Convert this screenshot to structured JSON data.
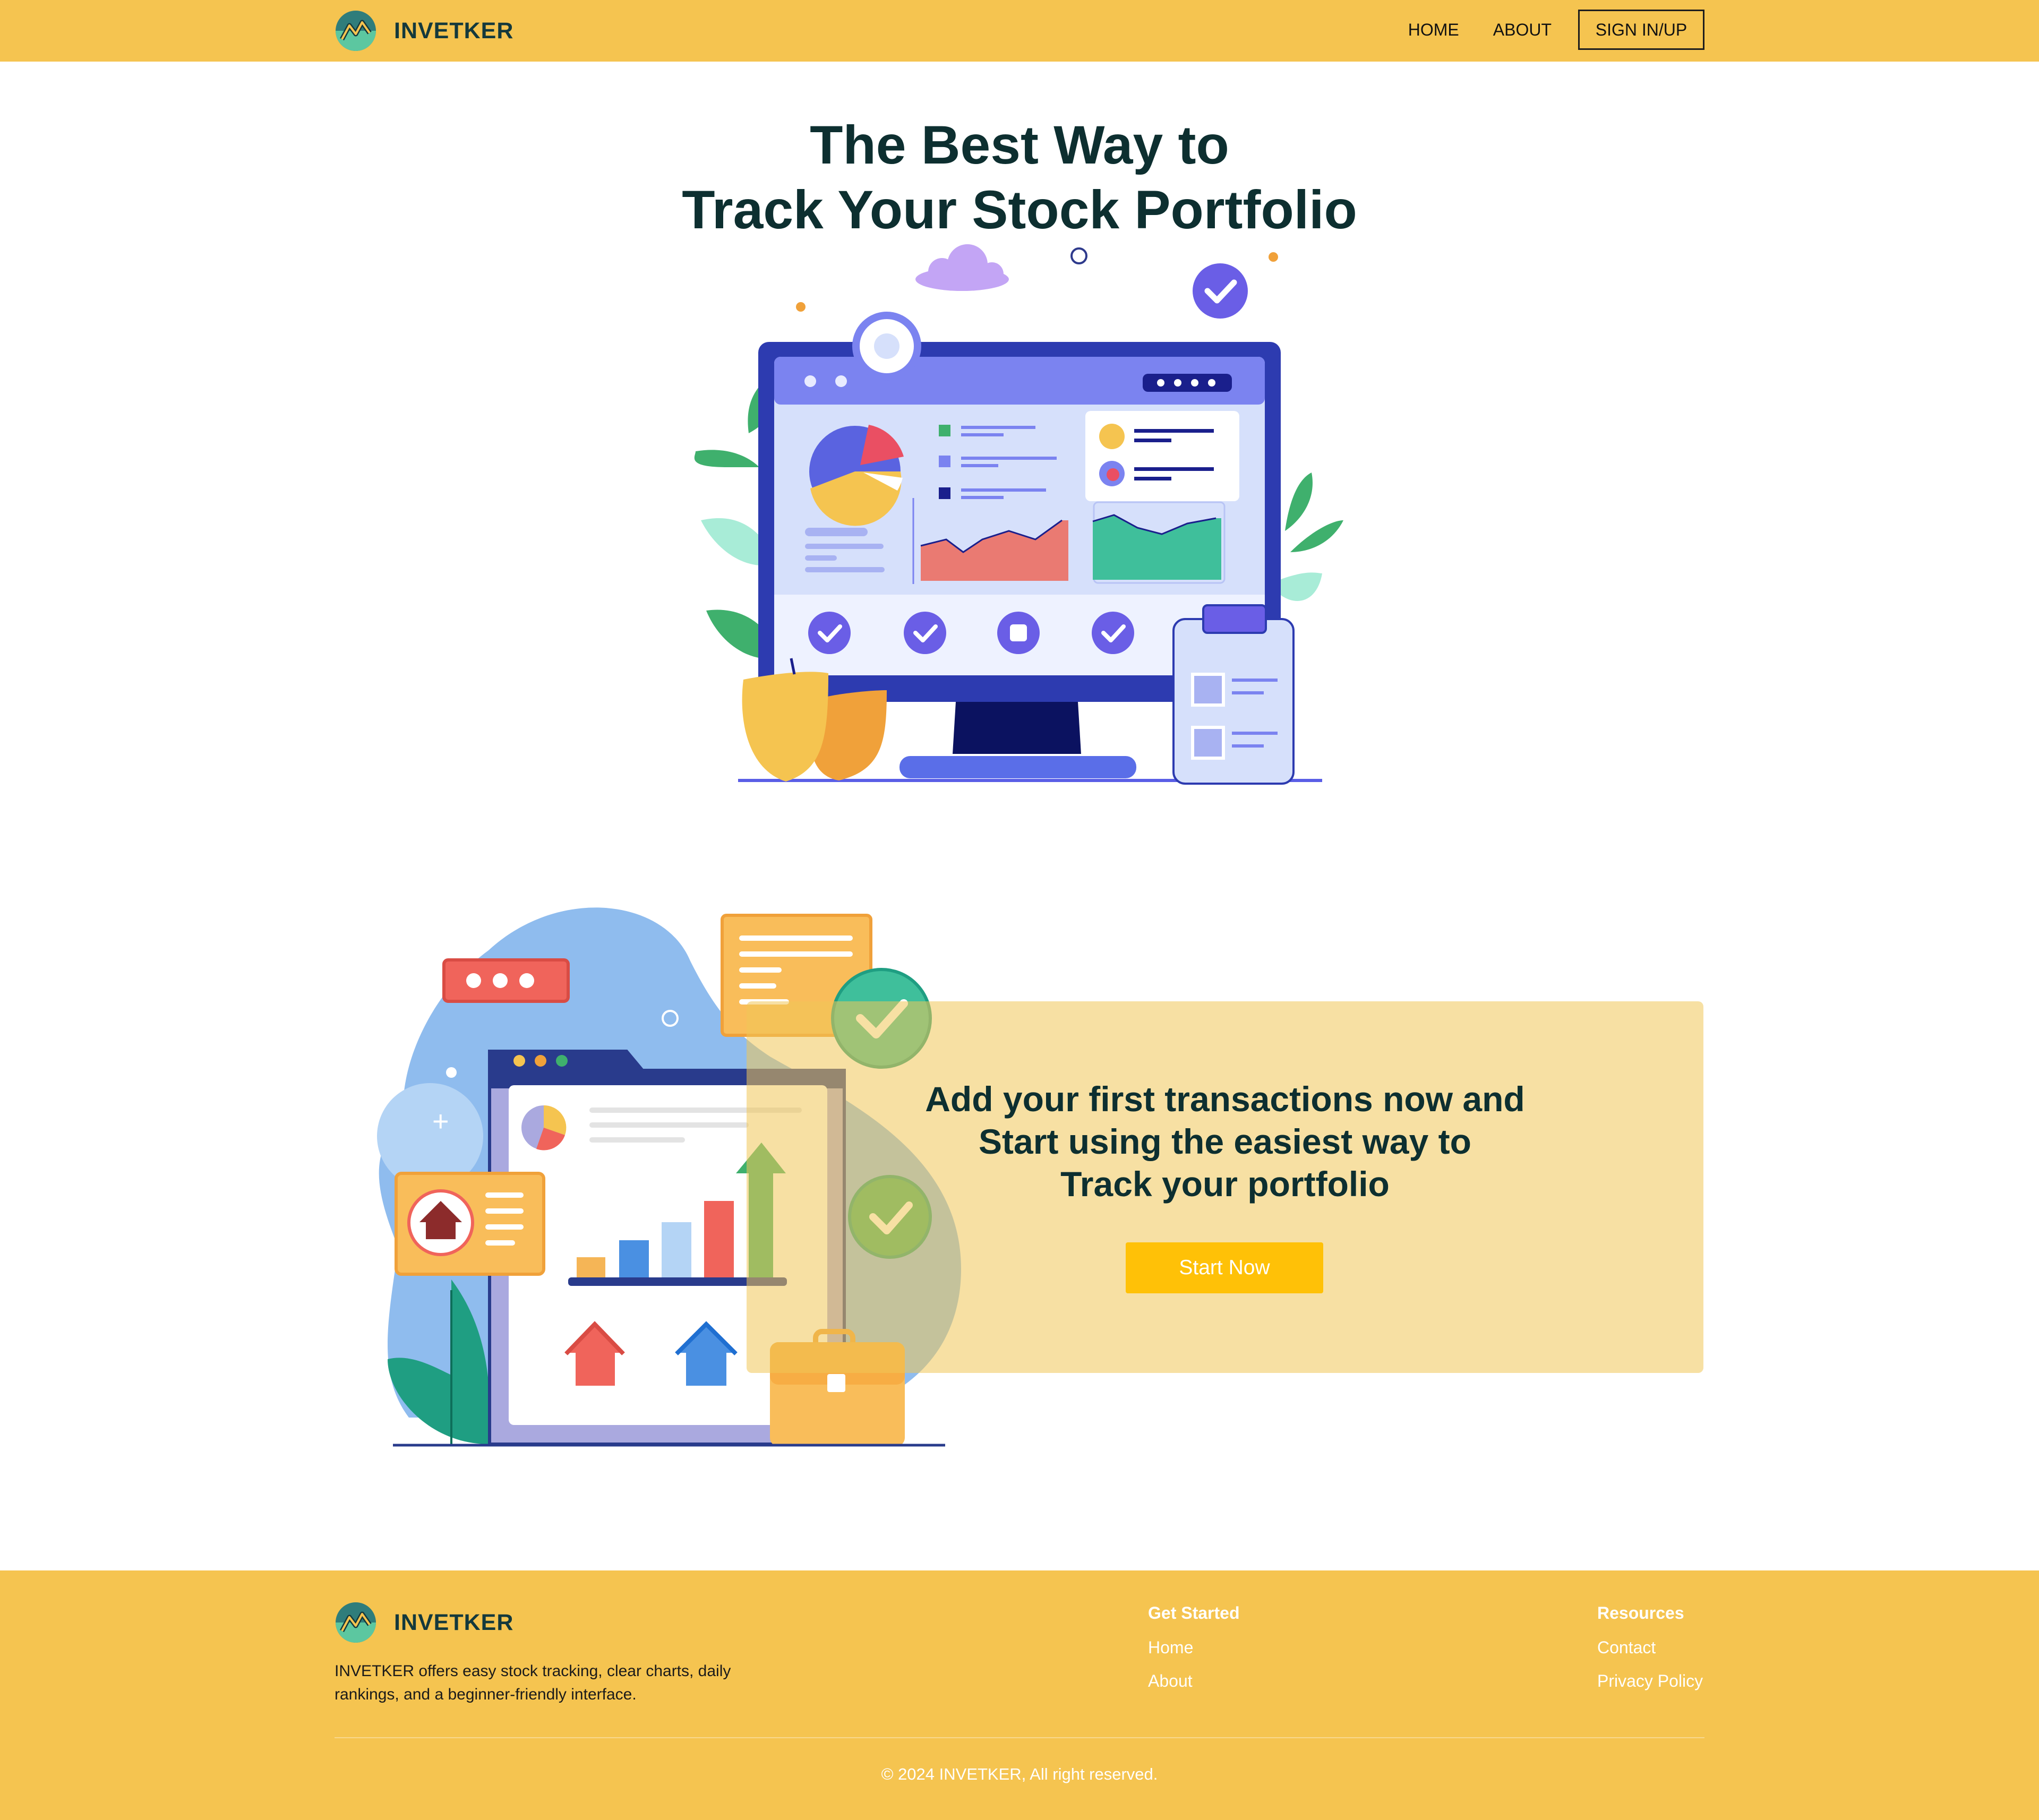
{
  "header": {
    "brand": "INVETKER",
    "nav": {
      "home": "HOME",
      "about": "ABOUT",
      "sign": "SIGN IN/UP"
    }
  },
  "hero": {
    "title_line1": "The Best Way to",
    "title_line2": "Track Your Stock Portfolio"
  },
  "cta": {
    "line1": "Add your first transactions now and",
    "line2": "Start using the easiest way to",
    "line3": "Track your portfolio",
    "button": "Start Now"
  },
  "footer": {
    "brand": "INVETKER",
    "description": "INVETKER offers easy stock tracking, clear charts, daily rankings, and a beginner-friendly interface.",
    "get_started": {
      "heading": "Get Started",
      "links": [
        "Home",
        "About"
      ]
    },
    "resources": {
      "heading": "Resources",
      "links": [
        "Contact",
        "Privacy Policy"
      ]
    },
    "copyright": "© 2024 INVETKER, All right reserved."
  },
  "colors": {
    "brand_yellow": "#f5c450",
    "button_yellow": "#ffc107",
    "heading_dark": "#0d2f30",
    "accent_purple": "#6a5ee6"
  },
  "icons": [
    "logo-icon",
    "check-icon",
    "pie-chart-icon",
    "bar-chart-icon",
    "house-icon",
    "briefcase-icon",
    "cloud-icon",
    "leaf-icon"
  ]
}
